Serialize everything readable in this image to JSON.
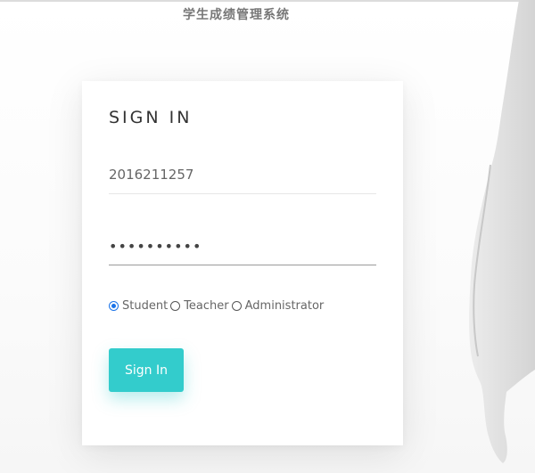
{
  "header": {
    "title": "学生成绩管理系统"
  },
  "login": {
    "heading": "SIGN IN",
    "username_value": "2016211257",
    "password_value": "••••••••••",
    "roles": [
      {
        "label": "Student",
        "selected": true
      },
      {
        "label": "Teacher",
        "selected": false
      },
      {
        "label": "Administrator",
        "selected": false
      }
    ],
    "submit_label": "Sign In"
  },
  "colors": {
    "accent": "#33cccc",
    "radio_selected": "#1a73e8",
    "title_text": "#777777"
  },
  "icons": {
    "background_figure": "person-silhouette"
  }
}
